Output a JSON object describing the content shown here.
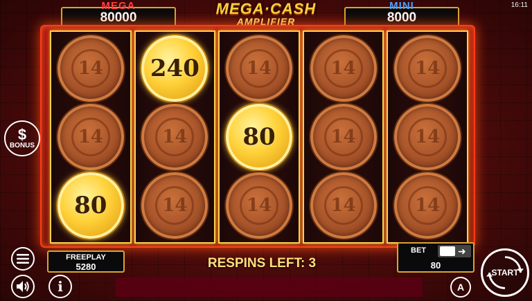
{
  "status_bar": {
    "time": "16:11"
  },
  "jackpots": {
    "mega": {
      "label": "MEGA",
      "value": "80000"
    },
    "mini": {
      "label": "MINI",
      "value": "8000"
    }
  },
  "logo": {
    "line1": "MEGA·CASH",
    "line2": "AMPLIFIER"
  },
  "reels": [
    [
      {
        "type": "blank",
        "emblem": "14"
      },
      {
        "type": "blank",
        "emblem": "14"
      },
      {
        "type": "gold",
        "value": "80"
      }
    ],
    [
      {
        "type": "gold",
        "value": "240"
      },
      {
        "type": "blank",
        "emblem": "14"
      },
      {
        "type": "blank",
        "emblem": "14"
      }
    ],
    [
      {
        "type": "blank",
        "emblem": "14"
      },
      {
        "type": "gold",
        "value": "80"
      },
      {
        "type": "blank",
        "emblem": "14"
      }
    ],
    [
      {
        "type": "blank",
        "emblem": "14"
      },
      {
        "type": "blank",
        "emblem": "14"
      },
      {
        "type": "blank",
        "emblem": "14"
      }
    ],
    [
      {
        "type": "blank",
        "emblem": "14"
      },
      {
        "type": "blank",
        "emblem": "14"
      },
      {
        "type": "blank",
        "emblem": "14"
      }
    ]
  ],
  "bonus_button": {
    "symbol": "$",
    "label": "BONUS"
  },
  "freeplay": {
    "label": "FREEPLAY",
    "value": "5280"
  },
  "respins_text": "RESPINS LEFT: 3",
  "bet": {
    "label": "BET",
    "value": "80"
  },
  "auto_button": {
    "label": "A"
  },
  "start_button": {
    "label": "START"
  },
  "icons": {
    "menu": "hamburger-menu-icon",
    "sound": "speaker-icon",
    "info": "info-icon",
    "auto": "autoplay-icon",
    "start": "start-spin-icon"
  }
}
